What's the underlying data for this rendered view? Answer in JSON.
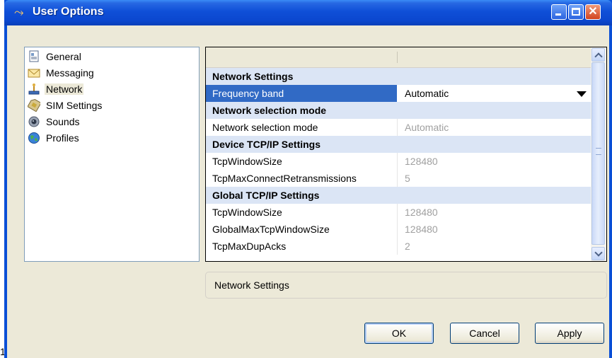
{
  "window": {
    "title": "User Options"
  },
  "stray_text": "1",
  "sidebar": {
    "items": [
      {
        "label": "General",
        "icon": "general-icon",
        "selected": false
      },
      {
        "label": "Messaging",
        "icon": "envelope-icon",
        "selected": false
      },
      {
        "label": "Network",
        "icon": "network-icon",
        "selected": true
      },
      {
        "label": "SIM Settings",
        "icon": "sim-card-icon",
        "selected": false
      },
      {
        "label": "Sounds",
        "icon": "speaker-icon",
        "selected": false
      },
      {
        "label": "Profiles",
        "icon": "globe-icon",
        "selected": false
      }
    ]
  },
  "property_grid": {
    "rows": [
      {
        "type": "category",
        "name": "Network Settings"
      },
      {
        "type": "property",
        "name": "Frequency band",
        "value": "Automatic",
        "selected": true,
        "dropdown": true
      },
      {
        "type": "category",
        "name": "Network selection mode"
      },
      {
        "type": "property",
        "name": "Network selection mode",
        "value": "Automatic"
      },
      {
        "type": "category",
        "name": "Device TCP/IP Settings"
      },
      {
        "type": "property",
        "name": "TcpWindowSize",
        "value": "128480"
      },
      {
        "type": "property",
        "name": "TcpMaxConnectRetransmissions",
        "value": "5"
      },
      {
        "type": "category",
        "name": "Global TCP/IP Settings"
      },
      {
        "type": "property",
        "name": "TcpWindowSize",
        "value": "128480"
      },
      {
        "type": "property",
        "name": "GlobalMaxTcpWindowSize",
        "value": "128480"
      },
      {
        "type": "property",
        "name": "TcpMaxDupAcks",
        "value": "2"
      }
    ]
  },
  "description": {
    "text": "Network Settings"
  },
  "buttons": {
    "ok": "OK",
    "cancel": "Cancel",
    "apply": "Apply"
  },
  "colors": {
    "titlebar": "#0a4fd6",
    "selection": "#316ac5",
    "category_bg": "#dbe5f5",
    "dialog_bg": "#ece9d8"
  }
}
